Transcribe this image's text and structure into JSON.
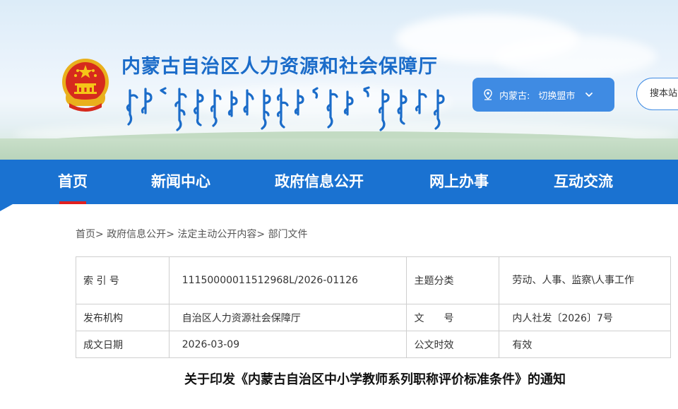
{
  "header": {
    "site_title": "内蒙古自治区人力资源和社会保障厅",
    "region": {
      "label": "内蒙古:",
      "switch_label": "切换盟市"
    },
    "search_placeholder": "搜本站"
  },
  "nav": {
    "items": [
      {
        "label": "首页",
        "active": true
      },
      {
        "label": "新闻中心",
        "active": false
      },
      {
        "label": "政府信息公开",
        "active": false
      },
      {
        "label": "网上办事",
        "active": false
      },
      {
        "label": "互动交流",
        "active": false
      }
    ]
  },
  "breadcrumb": {
    "items": [
      "首页",
      "政府信息公开",
      "法定主动公开内容",
      "部门文件"
    ],
    "separator": ">"
  },
  "info": {
    "index_no_label": "索 引 号",
    "index_no": "11150000011512968L/2026-01126",
    "category_label": "主题分类",
    "category": "劳动、人事、监察\\人事工作",
    "issuer_label": "发布机构",
    "issuer": "自治区人力资源社会保障厅",
    "doc_no_label": "文　　号",
    "doc_no": "内人社发〔2026〕7号",
    "date_label": "成文日期",
    "date": "2026-03-09",
    "validity_label": "公文时效",
    "validity": "有效"
  },
  "document": {
    "title": "关于印发《内蒙古自治区中小学教师系列职称评价标准条件》的通知"
  },
  "colors": {
    "brand_blue": "#1a72d1",
    "title_blue": "#1b6cc9",
    "active_underline": "#e11f1f",
    "switch_blue": "#3f8be3"
  }
}
